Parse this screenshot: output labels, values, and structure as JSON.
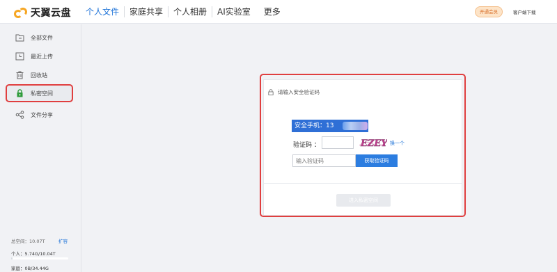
{
  "brand": {
    "name": "天翼云盘"
  },
  "nav": {
    "items": [
      "个人文件",
      "家庭共享",
      "个人相册",
      "AI实验室"
    ],
    "more": "更多"
  },
  "header": {
    "vip_label": "开通会员",
    "client_download": "客户端下载"
  },
  "sidebar": {
    "items": [
      {
        "label": "全部文件",
        "icon": "folder-icon"
      },
      {
        "label": "最近上传",
        "icon": "clock-icon"
      },
      {
        "label": "回收站",
        "icon": "trash-icon"
      },
      {
        "label": "私密空间",
        "icon": "lock-icon"
      },
      {
        "label": "文件分享",
        "icon": "share-icon"
      }
    ],
    "active_index": 3
  },
  "quota": {
    "total": "总空间：10.07T",
    "expand": "扩容",
    "personal": "个人：5.74G/10.04T",
    "personal_fraction": 0.0006,
    "family": "家庭：0B/34.44G"
  },
  "dialog": {
    "title": "请输入安全验证码",
    "phone_label": "安全手机：13",
    "captcha_label": "验证码 ：",
    "captcha_text": "EZEY",
    "refresh_link": "换一个",
    "sms_placeholder": "输入验证码",
    "get_code_button": "获取验证码",
    "enter_button": "进入私密空间"
  },
  "colors": {
    "accent": "#1e73d8",
    "highlight": "#e03f3f",
    "logo": "#f6a623",
    "active_icon": "#2e9b3b"
  }
}
